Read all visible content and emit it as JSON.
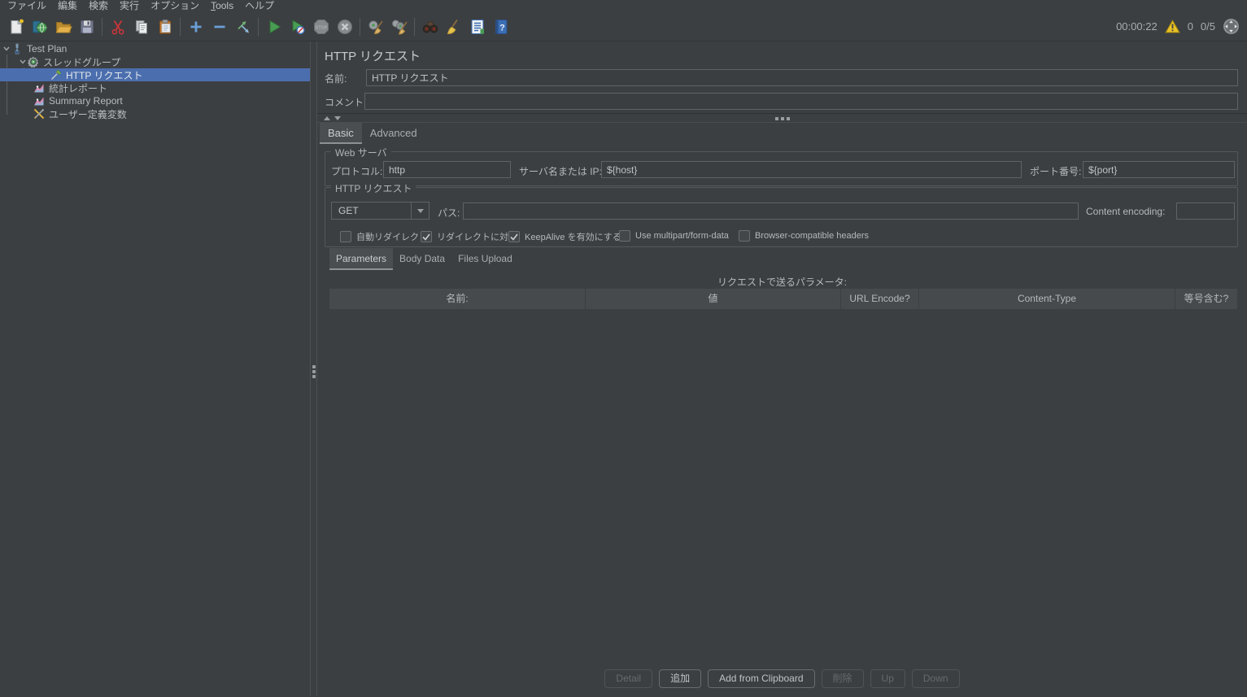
{
  "menubar": {
    "items": [
      "ファイル",
      "編集",
      "検索",
      "実行",
      "オプション",
      "Tools",
      "ヘルプ"
    ]
  },
  "toolbar": {
    "icons": [
      "new-file",
      "templates",
      "open-file",
      "save",
      "cut",
      "copy",
      "paste",
      "add",
      "remove",
      "toggle",
      "start",
      "start-no-timers",
      "stop",
      "shutdown",
      "clear-one",
      "clear-all",
      "search",
      "search-reset",
      "function-helper",
      "help"
    ],
    "status": {
      "elapsed": "00:00:22",
      "error_count": "0",
      "thread_count": "0/5"
    }
  },
  "tree": {
    "items": [
      {
        "label": "Test Plan",
        "icon": "test-plan"
      },
      {
        "label": "スレッドグループ",
        "icon": "thread-group"
      },
      {
        "label": "HTTP リクエスト",
        "icon": "http-request",
        "selected": true
      },
      {
        "label": "統計レポート",
        "icon": "report-chart"
      },
      {
        "label": "Summary Report",
        "icon": "report-chart"
      },
      {
        "label": "ユーザー定義変数",
        "icon": "user-defined-variables"
      }
    ]
  },
  "editor": {
    "title": "HTTP リクエスト",
    "name_label": "名前:",
    "name_value": "HTTP リクエスト",
    "comment_label": "コメント:",
    "comment_value": "",
    "tabs": [
      {
        "label": "Basic",
        "selected": true
      },
      {
        "label": "Advanced",
        "selected": false
      }
    ],
    "web_server": {
      "legend": "Web サーバ",
      "protocol_label": "プロトコル:",
      "protocol_value": "http",
      "server_label": "サーバ名または IP:",
      "server_value": "${host}",
      "port_label": "ポート番号:",
      "port_value": "${port}"
    },
    "http_request": {
      "legend": "HTTP リクエスト",
      "method_value": "GET",
      "path_label": "パス:",
      "path_value": "",
      "content_encoding_label": "Content encoding:",
      "content_encoding_value": "",
      "checkboxes": [
        {
          "label": "自動リダイレクト",
          "checked": false
        },
        {
          "label": "リダイレクトに対応",
          "checked": true
        },
        {
          "label": "KeepAlive を有効にする",
          "checked": true
        },
        {
          "label": "Use multipart/form-data",
          "checked": false
        },
        {
          "label": "Browser-compatible headers",
          "checked": false
        }
      ]
    },
    "body_tabs": [
      {
        "label": "Parameters",
        "selected": true
      },
      {
        "label": "Body Data",
        "selected": false
      },
      {
        "label": "Files Upload",
        "selected": false
      }
    ],
    "parameters_table": {
      "caption": "リクエストで送るパラメータ:",
      "columns": [
        "名前:",
        "値",
        "URL Encode?",
        "Content-Type",
        "等号含む?"
      ],
      "rows": []
    },
    "footer_buttons": [
      {
        "label": "Detail",
        "enabled": false
      },
      {
        "label": "追加",
        "enabled": true
      },
      {
        "label": "Add from Clipboard",
        "enabled": true
      },
      {
        "label": "削除",
        "enabled": false
      },
      {
        "label": "Up",
        "enabled": false
      },
      {
        "label": "Down",
        "enabled": false
      }
    ]
  },
  "colors": {
    "selection": "#4b6eaf",
    "warning": "#e8c227",
    "run_green": "#4a9c54"
  }
}
